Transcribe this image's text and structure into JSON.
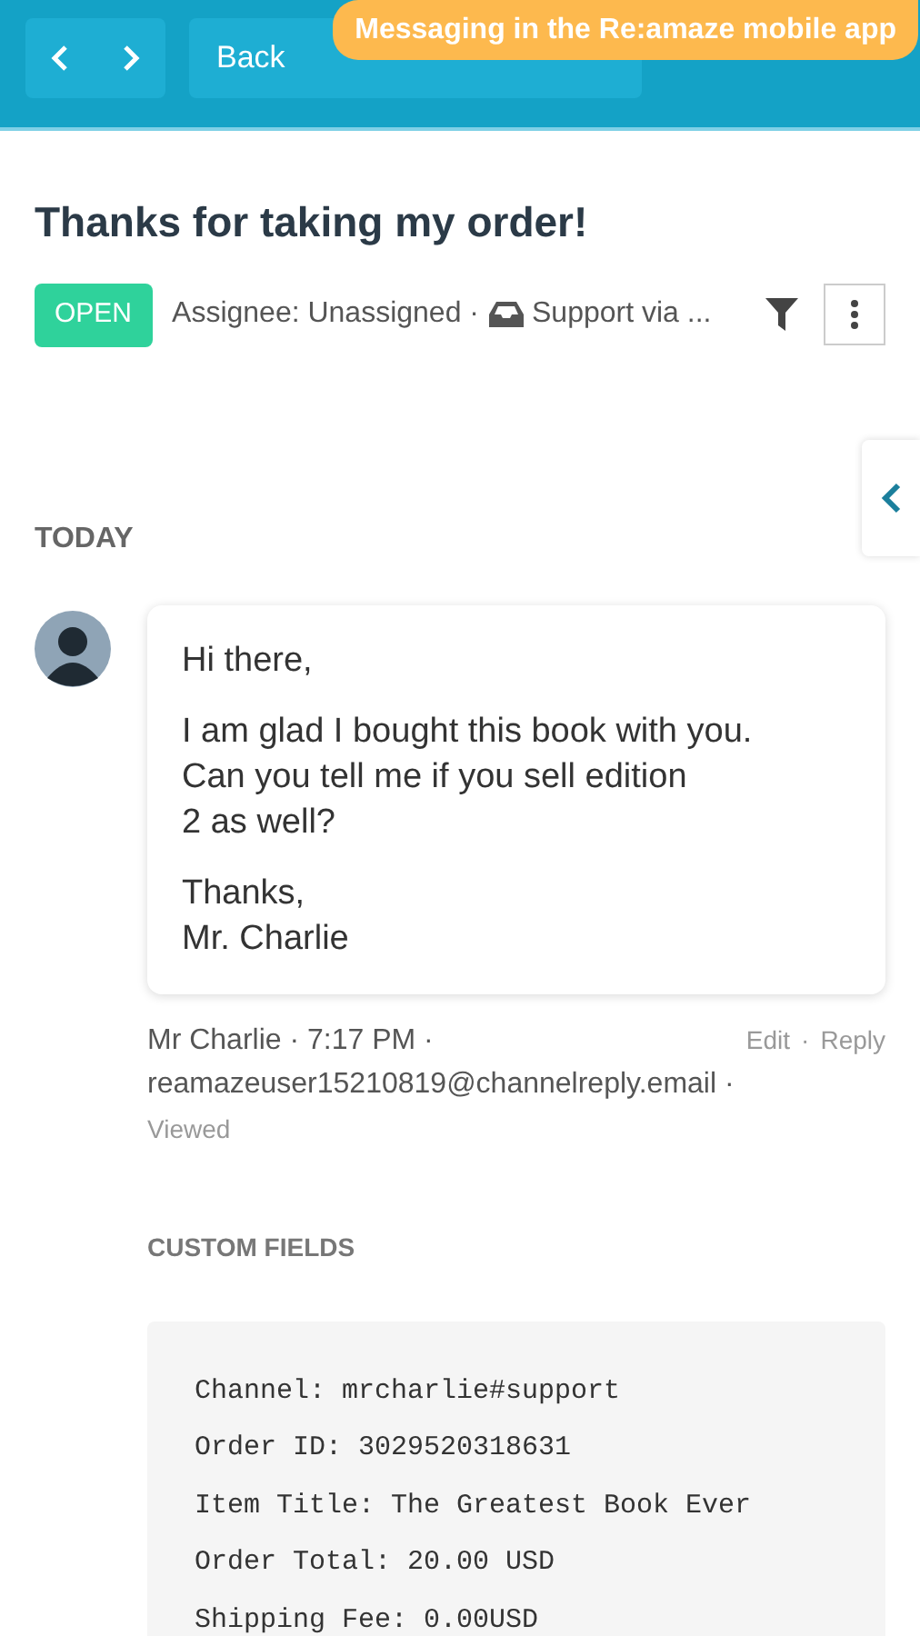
{
  "toolbar": {
    "actions": [
      "Back"
    ]
  },
  "banner": "Messaging in the Re:amaze mobile app",
  "conversation": {
    "title": "Thanks for taking my order!",
    "status": "OPEN",
    "meta": "Assignee: Unassigned ·",
    "channel": "Support via ..."
  },
  "day_label": "TODAY",
  "message": {
    "paragraphs": [
      [
        "Hi there,"
      ],
      [
        "I am glad I bought this book with you.",
        "Can you tell me if you sell edition",
        "2 as well?"
      ],
      [
        "Thanks,",
        "Mr. Charlie"
      ]
    ],
    "byline": "Mr Charlie · 7:17 PM ·",
    "email": "reamazeuser15210819@channelreply.email ·",
    "edit": "Edit",
    "separator": "·",
    "reply": "Reply",
    "receipt": "Viewed"
  },
  "custom_fields": {
    "heading": "CUSTOM FIELDS",
    "lines": [
      "Channel: mrcharlie#support",
      "Order ID: 3029520318631",
      "Item Title: The Greatest Book Ever",
      "Order Total: 20.00 USD",
      "Shipping Fee: 0.00USD"
    ]
  }
}
